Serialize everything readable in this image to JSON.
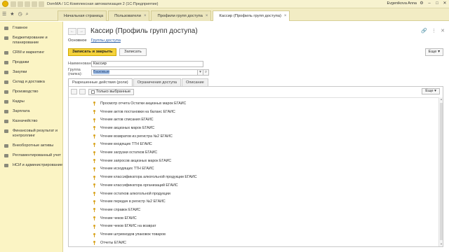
{
  "window": {
    "title": "DomMA / 1С:Комплексная автоматизация 2 (1С:Предприятие)",
    "user": "Evgenikova Anna"
  },
  "tabs": [
    {
      "label": "Начальная страница",
      "active": false
    },
    {
      "label": "Пользователи",
      "active": false
    },
    {
      "label": "Профили групп доступа",
      "active": false
    },
    {
      "label": "Кассир (Профиль групп доступа)",
      "active": true
    }
  ],
  "sidebar": {
    "items": [
      {
        "label": "Главное"
      },
      {
        "label": "Бюджетирование и планирование"
      },
      {
        "label": "CRM и маркетинг"
      },
      {
        "label": "Продажи"
      },
      {
        "label": "Закупки"
      },
      {
        "label": "Склад и доставка"
      },
      {
        "label": "Производство"
      },
      {
        "label": "Кадры"
      },
      {
        "label": "Зарплата"
      },
      {
        "label": "Казначейство"
      },
      {
        "label": "Финансовый результат и контроллинг"
      },
      {
        "label": "Внеоборотные активы"
      },
      {
        "label": "Регламентированный учет"
      },
      {
        "label": "НСИ и администрирование"
      }
    ]
  },
  "form": {
    "title": "Кассир (Профиль групп доступа)",
    "nav_tabs": {
      "main": "Основное",
      "link": "Группы доступа"
    },
    "buttons": {
      "save_close": "Записать и закрыть",
      "save": "Записать",
      "more": "Еще"
    },
    "fields": {
      "name_label": "Наименование:",
      "name_value": "Кассир",
      "group_label": "Группа (папка):",
      "group_value": "Базовые"
    },
    "subtabs": [
      "Разрешенные действия (роли)",
      "Ограничения доступа",
      "Описание"
    ],
    "panel": {
      "only_selected": "Только выбранные",
      "more": "Еще"
    },
    "roles": [
      "Просмотр отчета Остатки акцизных марок ЕГАИС",
      "Чтение актов постановки на баланс ЕГАИС",
      "Чтение актов списания ЕГАИС",
      "Чтение акцизных марок ЕГАИС",
      "Чтение возвратов из регистра №2 ЕГАИС",
      "Чтение входящих ТТН ЕГАИС",
      "Чтение загрузки остатков ЕГАИС",
      "Чтение запросов акцизных марок ЕГАИС",
      "Чтение исходящих ТТН ЕГАИС",
      "Чтение классификатора алкогольной продукции ЕГАИС",
      "Чтение классификатора организаций ЕГАИС",
      "Чтение остатков алкогольной продукции",
      "Чтение передач в регистр №2 ЕГАИС",
      "Чтение справок ЕГАИС",
      "Чтение чеков ЕГАИС",
      "Чтение чеков ЕГАИС на возврат",
      "Чтение штрихкодов упаковок товаров",
      "Отчеты ЕГАИС"
    ]
  },
  "colors": {
    "sidebar_bg": "#fbf4c4",
    "tabstrip_bg": "#f2ecc4",
    "primary_button": "#f5d23c",
    "role_icon": "#d9a31e",
    "selection": "#a9c5ea"
  }
}
